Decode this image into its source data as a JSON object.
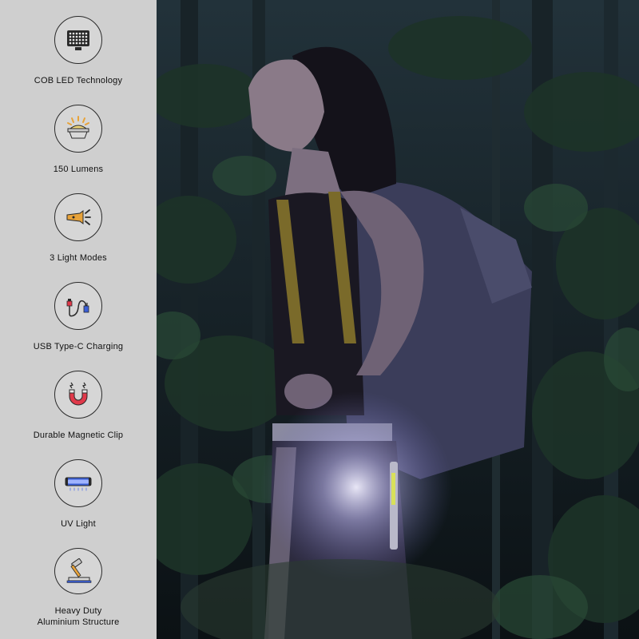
{
  "features": [
    {
      "label": "COB LED Technology",
      "icon": "cob-led-panel-icon"
    },
    {
      "label": "150 Lumens",
      "icon": "glowing-bulb-icon"
    },
    {
      "label": "3 Light Modes",
      "icon": "flashlight-icon"
    },
    {
      "label": "USB Type-C Charging",
      "icon": "usb-charging-cable-icon"
    },
    {
      "label": "Durable Magnetic Clip",
      "icon": "magnet-icon"
    },
    {
      "label": "UV Light",
      "icon": "uv-light-bar-icon"
    },
    {
      "label": "Heavy Duty\nAluminium Structure",
      "icon": "hammer-on-plate-icon"
    }
  ],
  "colors": {
    "panel_bg": "#cfcfcf",
    "icon_accent_orange": "#e8a33a",
    "icon_accent_red": "#e0394a",
    "icon_accent_blue": "#3b5fd6"
  }
}
